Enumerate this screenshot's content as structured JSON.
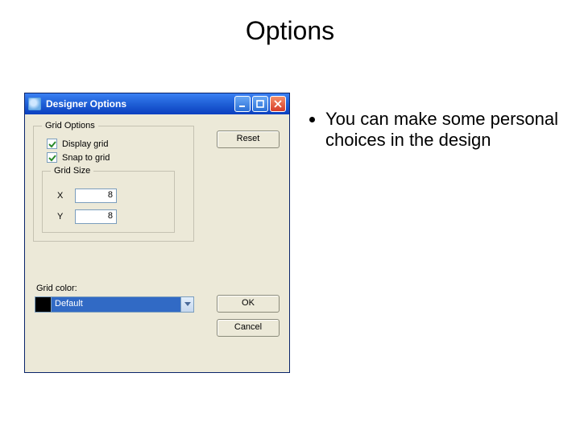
{
  "slide": {
    "title": "Options",
    "bullet": "You can make some personal choices in the design"
  },
  "window": {
    "title": "Designer Options",
    "groups": {
      "grid_options_legend": "Grid Options",
      "display_grid_label": "Display grid",
      "snap_to_grid_label": "Snap to grid",
      "grid_size_legend": "Grid Size",
      "x_label": "X",
      "y_label": "Y",
      "x_value": "8",
      "y_value": "8",
      "grid_color_label": "Grid color:",
      "color_selected": "Default"
    },
    "buttons": {
      "reset": "Reset",
      "ok": "OK",
      "cancel": "Cancel"
    },
    "state": {
      "display_grid_checked": true,
      "snap_to_grid_checked": true,
      "color_swatch": "#000000"
    }
  }
}
